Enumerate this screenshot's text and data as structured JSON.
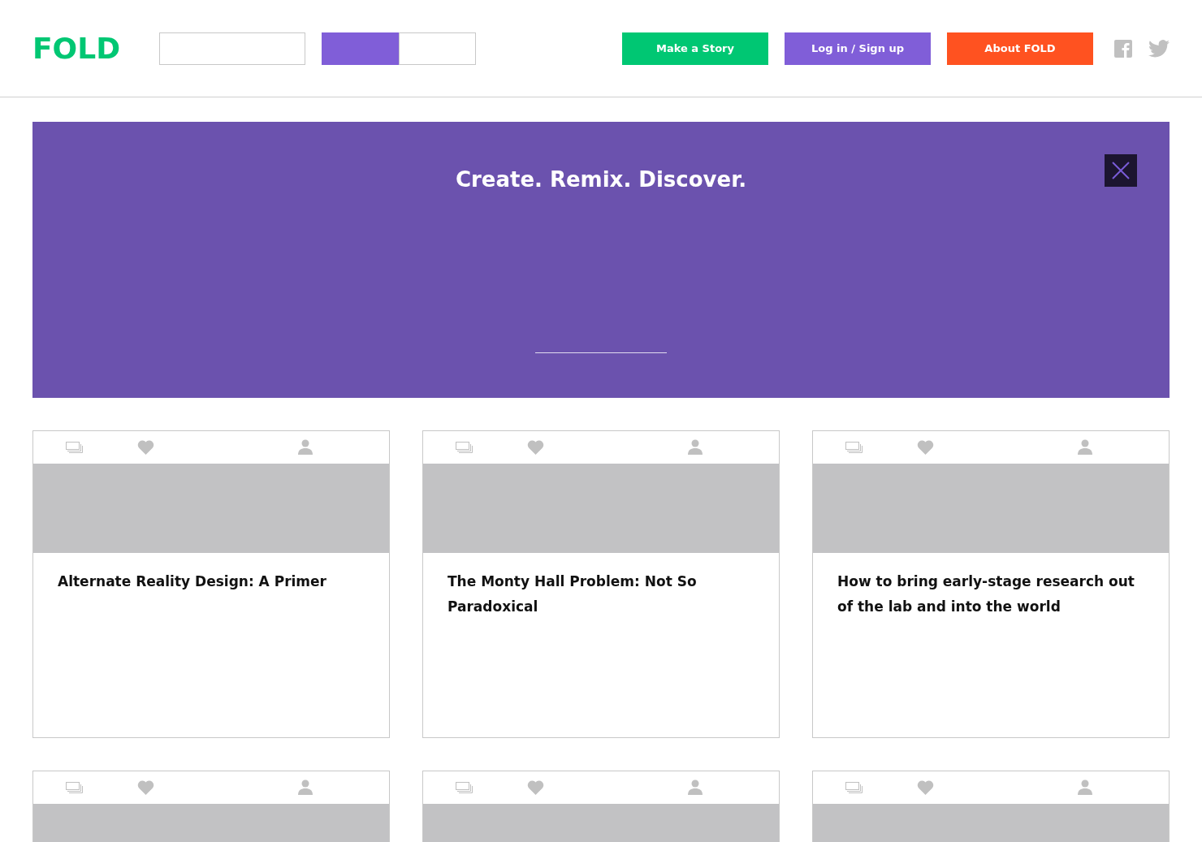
{
  "header": {
    "logo": "FOLD",
    "toggle": [
      {
        "selected": true
      },
      {
        "selected": false
      }
    ],
    "buttons": [
      {
        "label": "Make a Story",
        "color": "#00c773"
      },
      {
        "label": "Log in / Sign up",
        "color": "#805ed8"
      },
      {
        "label": "About FOLD",
        "color": "#ff5220"
      }
    ]
  },
  "banner": {
    "title": "Create. Remix. Discover."
  },
  "stories": [
    {
      "kind": "full",
      "title": "Alternate Reality Design: A Primer"
    },
    {
      "kind": "full",
      "title": "The Monty Hall Problem: Not So Paradoxical"
    },
    {
      "kind": "full",
      "title": "How to bring early-stage research out of the lab and into the world"
    },
    {
      "kind": "cut"
    },
    {
      "kind": "cut"
    },
    {
      "kind": "cut"
    }
  ]
}
